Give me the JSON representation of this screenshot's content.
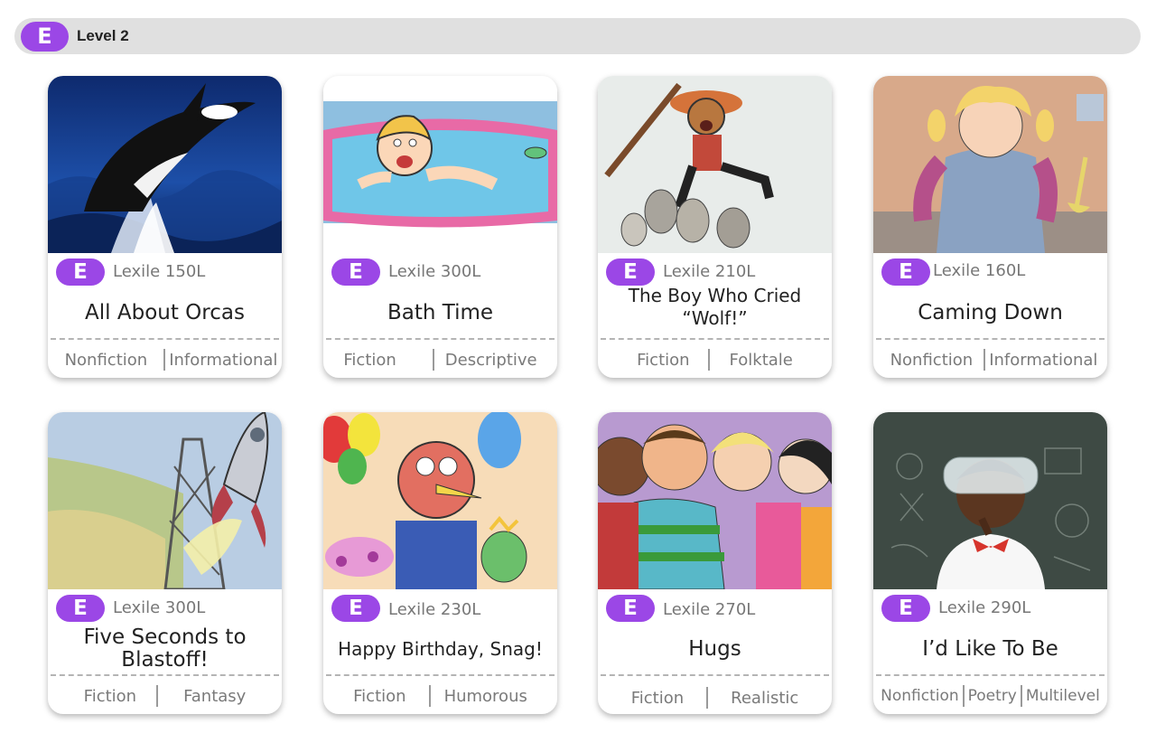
{
  "level": {
    "badge": "E",
    "title": "Level 2"
  },
  "colors": {
    "accent": "#9b47e6",
    "bar": "#e0e0e0"
  },
  "books": [
    {
      "badge": "E",
      "lexile": "Lexile 150L",
      "title": "All About Orcas",
      "genres": [
        "Nonfiction",
        "Informational"
      ]
    },
    {
      "badge": "E",
      "lexile": "Lexile 300L",
      "title": "Bath Time",
      "genres": [
        "Fiction",
        "Descriptive"
      ]
    },
    {
      "badge": "E",
      "lexile": "Lexile  210L",
      "title": "The Boy Who Cried “Wolf!”",
      "genres": [
        "Fiction",
        "Folktale"
      ]
    },
    {
      "badge": "E",
      "lexile": "Lexile 160L",
      "title": "Caming Down",
      "genres": [
        "Nonfiction",
        "Informational"
      ]
    },
    {
      "badge": "E",
      "lexile": "Lexile 300L",
      "title": "Five Seconds to Blastoff!",
      "genres": [
        "Fiction",
        "Fantasy"
      ]
    },
    {
      "badge": "E",
      "lexile": "Lexile 230L",
      "title": "Happy Birthday, Snag!",
      "genres": [
        "Fiction",
        "Humorous"
      ]
    },
    {
      "badge": "E",
      "lexile": "Lexile 270L",
      "title": "Hugs",
      "genres": [
        "Fiction",
        "Realistic"
      ]
    },
    {
      "badge": "E",
      "lexile": "Lexile 290L",
      "title": "I’d Like To Be",
      "genres": [
        "Nonfiction",
        "Poetry",
        "Multilevel"
      ]
    }
  ]
}
